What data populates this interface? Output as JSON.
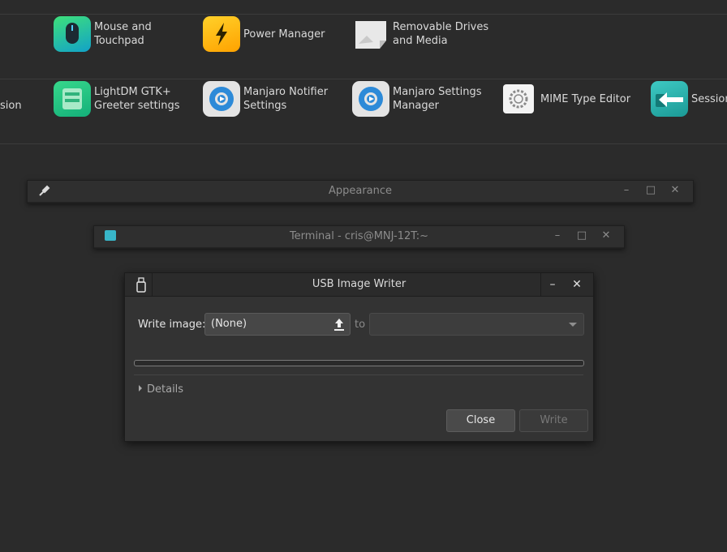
{
  "settings": {
    "row1": [
      {
        "label": "Mouse and\nTouchpad",
        "icon": "mouse-icon"
      },
      {
        "label": "Power Manager",
        "icon": "power-manager-icon"
      },
      {
        "label": "Removable Drives\nand Media",
        "icon": "removable-drives-icon"
      }
    ],
    "row2_fragment": "sion",
    "row2": [
      {
        "label": "LightDM GTK+\nGreeter settings",
        "icon": "lightdm-icon"
      },
      {
        "label": "Manjaro Notifier\nSettings",
        "icon": "manjaro-notifier-icon"
      },
      {
        "label": "Manjaro Settings\nManager",
        "icon": "manjaro-settings-icon"
      },
      {
        "label": "MIME Type Editor",
        "icon": "mime-type-icon"
      },
      {
        "label": "Session",
        "icon": "session-icon"
      }
    ]
  },
  "appearance_window": {
    "title": "Appearance"
  },
  "terminal_window": {
    "title": "Terminal - cris@MNJ-12T:~"
  },
  "usb_dialog": {
    "title": "USB Image Writer",
    "write_image_label": "Write image:",
    "image_value": "(None)",
    "to_label": "to",
    "device_value": "",
    "progress": 0,
    "details_label": "Details",
    "close_label": "Close",
    "write_label": "Write"
  },
  "colors": {
    "background": "#2b2b2b",
    "dialog": "#333333",
    "accent_blue": "#2d8ad8"
  }
}
